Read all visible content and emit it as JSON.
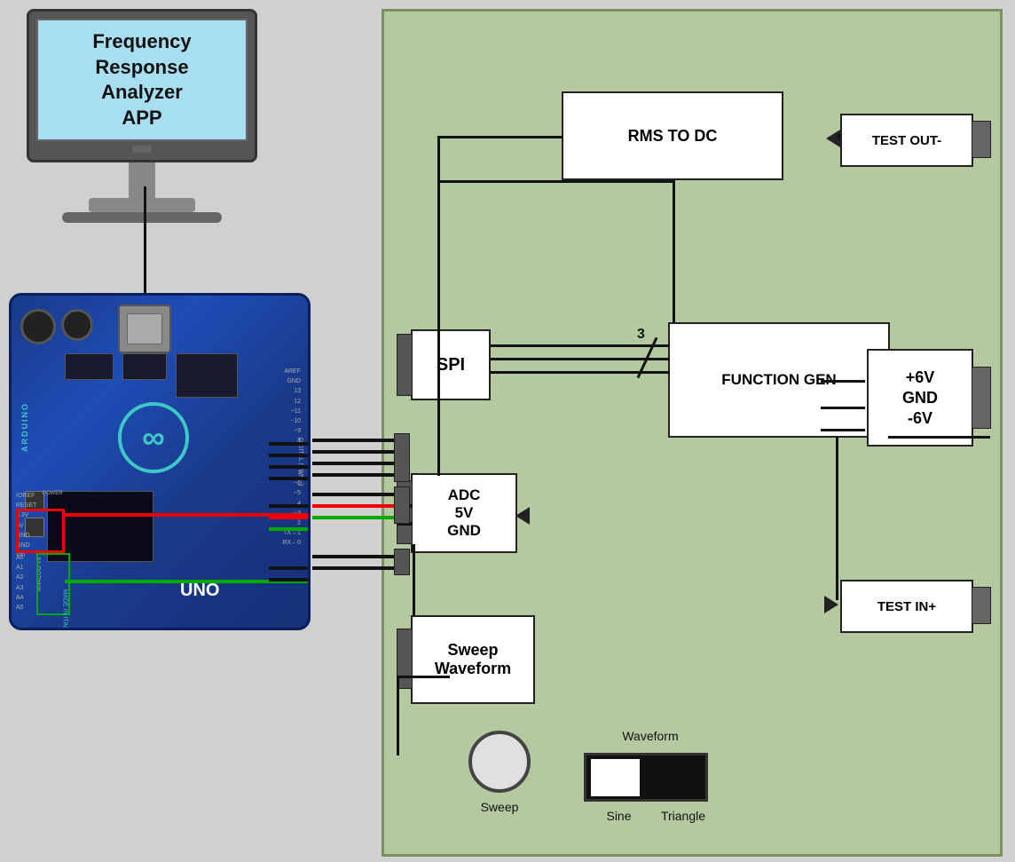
{
  "monitor": {
    "title_line1": "Frequency Response",
    "title_line2": "Analyzer",
    "title_line3": "APP"
  },
  "circuit": {
    "rms_to_dc_label": "RMS TO DC",
    "test_out_label": "TEST OUT-",
    "function_gen_label": "FUNCTION GEN",
    "power_label": "+6V\nGND\n-6V",
    "power_line1": "+6V",
    "power_line2": "GND",
    "power_line3": "-6V",
    "test_in_label": "TEST IN+",
    "spi_label": "SPI",
    "adc_label": "ADC\n5V\nGND",
    "adc_line1": "ADC",
    "adc_line2": "5V",
    "adc_line3": "GND",
    "sweep_waveform_label": "Sweep\nWaveform",
    "sweep_waveform_line1": "Sweep",
    "sweep_waveform_line2": "Waveform",
    "num_label": "3",
    "sweep_text": "Sweep",
    "waveform_text": "Waveform",
    "sine_text": "Sine",
    "triangle_text": "Triangle"
  }
}
